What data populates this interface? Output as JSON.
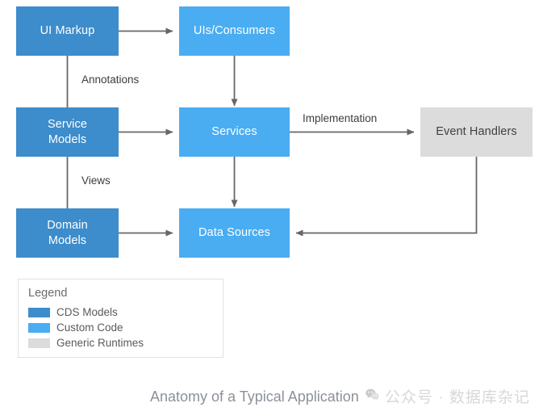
{
  "diagram": {
    "title": "Anatomy of a Typical Application",
    "nodes": [
      {
        "id": "ui-markup",
        "label": "UI Markup",
        "category": "cds"
      },
      {
        "id": "uis-consumers",
        "label": "UIs/Consumers",
        "category": "custom"
      },
      {
        "id": "service-models",
        "label": "Service\nModels",
        "category": "cds"
      },
      {
        "id": "services",
        "label": "Services",
        "category": "custom"
      },
      {
        "id": "event-handlers",
        "label": "Event Handlers",
        "category": "runtime"
      },
      {
        "id": "domain-models",
        "label": "Domain\nModels",
        "category": "cds"
      },
      {
        "id": "data-sources",
        "label": "Data Sources",
        "category": "custom"
      }
    ],
    "edge_labels": {
      "annotations": "Annotations",
      "views": "Views",
      "implementation": "Implementation"
    }
  },
  "legend": {
    "title": "Legend",
    "items": [
      {
        "label": "CDS Models",
        "color": "#3d8ccb"
      },
      {
        "label": "Custom Code",
        "color": "#4aadf2"
      },
      {
        "label": "Generic Runtimes",
        "color": "#dcdcdc"
      }
    ]
  },
  "watermark": {
    "icon": "wechat-icon",
    "text": "公众号 · 数据库杂记"
  },
  "colors": {
    "cds_models": "#3d8ccb",
    "custom_code": "#4aadf2",
    "generic_runtimes": "#dcdcdc",
    "connector": "#666666",
    "caption_text": "#8b9199"
  }
}
